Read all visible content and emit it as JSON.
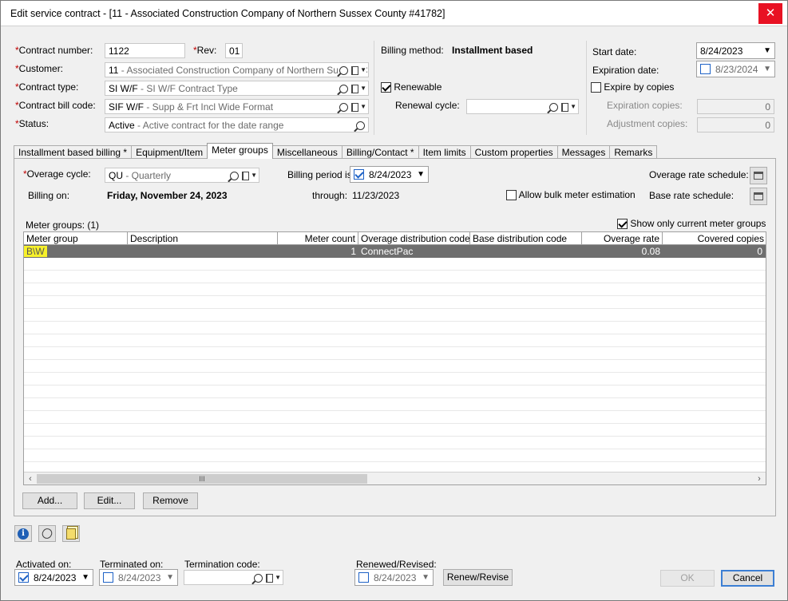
{
  "window": {
    "title": "Edit service contract - [11 - Associated Construction Company of Northern Sussex County #41782]",
    "close_label": "✕"
  },
  "header": {
    "contract_number_label": "Contract number:",
    "contract_number": "1122",
    "rev_label": "Rev:",
    "rev": "01",
    "customer_label": "Customer:",
    "customer_code": "11",
    "customer_desc": " - Associated Construction Company of Northern Sussex C",
    "contract_type_label": "Contract type:",
    "contract_type_code": "SI W/F",
    "contract_type_desc": " - SI W/F  Contract Type",
    "bill_code_label": "Contract bill code:",
    "bill_code": "SIF W/F",
    "bill_code_desc": " - Supp & Frt Incl Wide Format",
    "status_label": "Status:",
    "status_code": "Active",
    "status_desc": " - Active contract for the date range",
    "billing_method_label": "Billing method:",
    "billing_method": "Installment based",
    "renewable_label": "Renewable",
    "renewal_cycle_label": "Renewal cycle:",
    "start_date_label": "Start date:",
    "start_date": "8/24/2023",
    "expiration_date_label": "Expiration date:",
    "expiration_date": "8/23/2024",
    "expire_by_copies_label": "Expire by copies",
    "expiration_copies_label": "Expiration copies:",
    "expiration_copies": "0",
    "adjustment_copies_label": "Adjustment copies:",
    "adjustment_copies": "0"
  },
  "tabs": [
    {
      "label": "Installment based billing *"
    },
    {
      "label": "Equipment/Item"
    },
    {
      "label": "Meter groups"
    },
    {
      "label": "Miscellaneous"
    },
    {
      "label": "Billing/Contact *"
    },
    {
      "label": "Item limits"
    },
    {
      "label": "Custom properties"
    },
    {
      "label": "Messages"
    },
    {
      "label": "Remarks"
    }
  ],
  "meter": {
    "overage_cycle_label": "Overage cycle:",
    "overage_cycle_code": "QU",
    "overage_cycle_desc": " - Quarterly",
    "billing_period_label": "Billing period is:",
    "billing_period": "8/24/2023",
    "overage_rate_schedule_label": "Overage rate schedule:",
    "billing_on_label": "Billing on:",
    "billing_on": "Friday, November 24, 2023",
    "through_label": "through:",
    "through": "11/23/2023",
    "allow_bulk_label": "Allow bulk meter estimation",
    "base_rate_schedule_label": "Base rate schedule:",
    "meter_groups_count_label": "Meter groups: (1)",
    "show_current_label": "Show only current meter groups"
  },
  "grid": {
    "columns": [
      "Meter group",
      "Description",
      "Meter count",
      "Overage distribution code",
      "Base distribution code",
      "Overage rate",
      "Covered copies"
    ],
    "rows": [
      {
        "meter_group": "B\\W",
        "description": "",
        "meter_count": "1",
        "overage_dist": "ConnectPac",
        "base_dist": "",
        "overage_rate": "0.08",
        "covered_copies": "0"
      }
    ]
  },
  "panel_buttons": {
    "add": "Add...",
    "edit": "Edit...",
    "remove": "Remove"
  },
  "footer": {
    "activated_on_label": "Activated on:",
    "activated_on": "8/24/2023",
    "terminated_on_label": "Terminated on:",
    "terminated_on": "8/24/2023",
    "termination_code_label": "Termination code:",
    "renewed_revised_label": "Renewed/Revised:",
    "renewed_revised": "8/24/2023",
    "renew_revise_button": "Renew/Revise",
    "ok_button": "OK",
    "cancel_button": "Cancel"
  },
  "icons": {
    "scroll_left": "‹",
    "scroll_right": "›",
    "grip": "III",
    "dropdown": "▼",
    "info": "i"
  }
}
